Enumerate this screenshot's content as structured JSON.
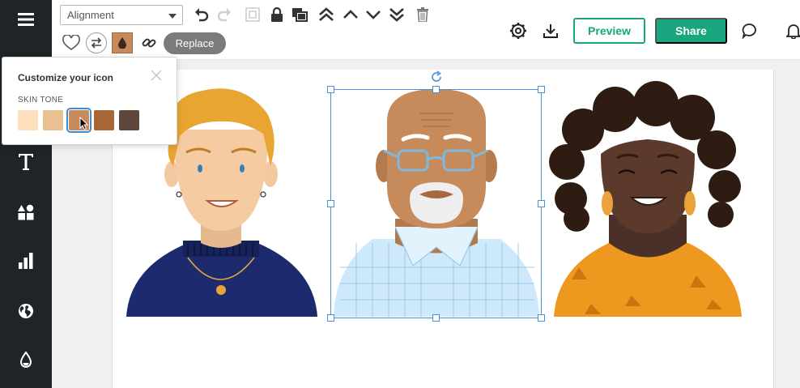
{
  "sidebar": {
    "items": [
      {
        "name": "menu",
        "icon": "hamburger-menu-icon"
      },
      {
        "name": "text",
        "icon": "text-icon",
        "glyph": "T"
      },
      {
        "name": "shapes",
        "icon": "shapes-icon"
      },
      {
        "name": "charts",
        "icon": "bar-chart-icon"
      },
      {
        "name": "maps",
        "icon": "globe-icon"
      },
      {
        "name": "colors",
        "icon": "droplet-icon"
      }
    ]
  },
  "toolbar": {
    "alignment": "Alignment",
    "replace": "Replace",
    "preview": "Preview",
    "share": "Share"
  },
  "popover": {
    "title": "Customize your icon",
    "section_label": "SKIN TONE",
    "tones": [
      "#fddfbd",
      "#e8c091",
      "#c68a5b",
      "#a86634",
      "#5e463b"
    ],
    "selected_index": 2
  },
  "colors": {
    "accent": "#19a57e",
    "sidebar": "#1f2428",
    "selection": "#4a90d9"
  }
}
